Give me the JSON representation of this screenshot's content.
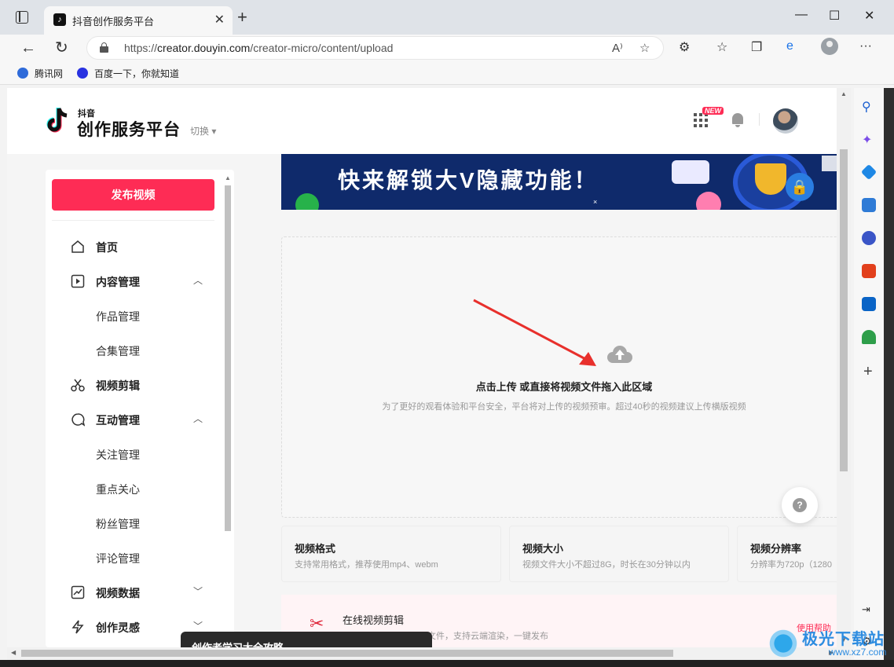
{
  "browser": {
    "tab_title": "抖音创作服务平台",
    "url_prefix": "https://",
    "url_domain": "creator.douyin.com",
    "url_path": "/creator-micro/content/upload",
    "bookmarks": [
      {
        "label": "腾讯网",
        "color": "#2f6bd9"
      },
      {
        "label": "百度一下，你就知道",
        "color": "#2932e1"
      }
    ]
  },
  "header": {
    "logo_small": "抖音",
    "logo_title": "创作服务平台",
    "switch_label": "切换 ▾",
    "new_badge": "NEW"
  },
  "sidebar": {
    "publish_label": "发布视频",
    "items": [
      {
        "label": "首页",
        "icon": "home-icon",
        "type": "main"
      },
      {
        "label": "内容管理",
        "icon": "play-square-icon",
        "type": "main",
        "chevron": "^"
      },
      {
        "label": "作品管理",
        "type": "sub"
      },
      {
        "label": "合集管理",
        "type": "sub"
      },
      {
        "label": "视频剪辑",
        "icon": "scissors-icon",
        "type": "main"
      },
      {
        "label": "互动管理",
        "icon": "chat-icon",
        "type": "main",
        "chevron": "^"
      },
      {
        "label": "关注管理",
        "type": "sub"
      },
      {
        "label": "重点关心",
        "type": "sub"
      },
      {
        "label": "粉丝管理",
        "type": "sub"
      },
      {
        "label": "评论管理",
        "type": "sub"
      },
      {
        "label": "视频数据",
        "icon": "chart-icon",
        "type": "main",
        "chevron": "v"
      },
      {
        "label": "创作灵感",
        "icon": "bolt-icon",
        "type": "main",
        "chevron": "v"
      }
    ]
  },
  "banner": {
    "text": "快来解锁大V隐藏功能！",
    "close": "×"
  },
  "upload": {
    "title": "点击上传 或直接将视频文件拖入此区域",
    "desc": "为了更好的观看体验和平台安全，平台将对上传的视频预审。超过40秒的视频建议上传横版视频"
  },
  "cards": [
    {
      "title": "视频格式",
      "desc": "支持常用格式，推荐使用mp4、webm"
    },
    {
      "title": "视频大小",
      "desc": "视频文件大小不超过8G，时长在30分钟以内"
    },
    {
      "title": "视频分辨率",
      "desc": "分辨率为720p（1280"
    }
  ],
  "online_edit": {
    "title": "在线视频剪辑",
    "desc": "文件，支持云端渲染，一键发布",
    "help": "使用帮助"
  },
  "toast": {
    "text": "创作者学习大全攻略"
  },
  "help_button": "?",
  "watermark": {
    "text": "极光下载站",
    "url": "www.xz7.com"
  }
}
